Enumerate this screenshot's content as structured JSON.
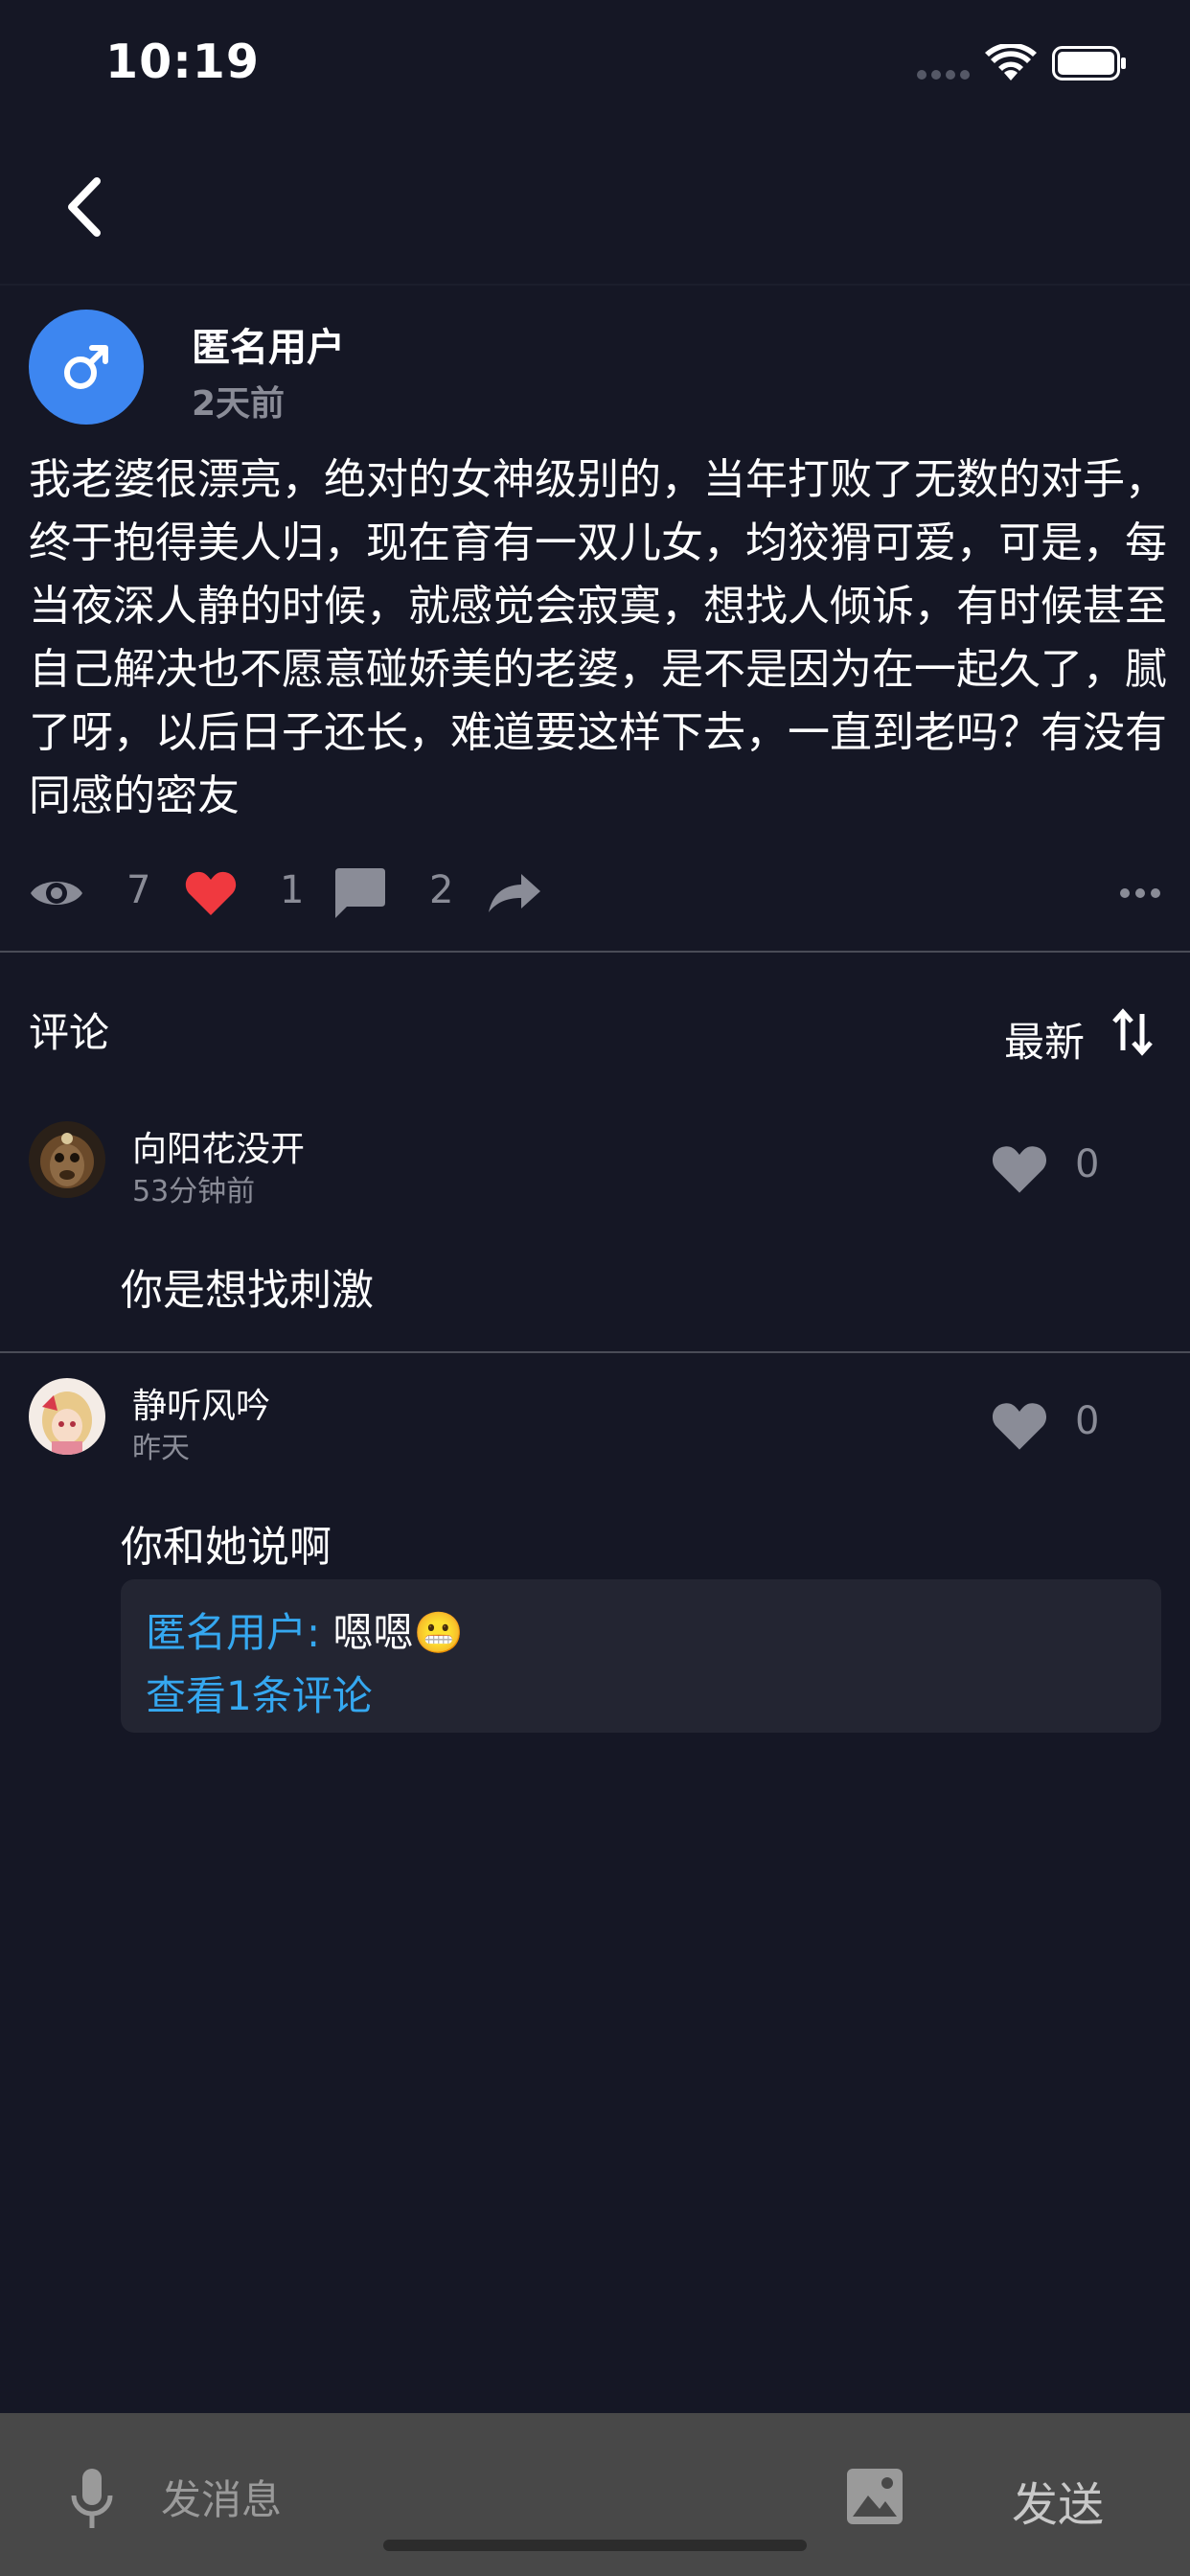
{
  "status_bar": {
    "time": "10:19"
  },
  "post": {
    "author": {
      "name": "匿名用户",
      "time": "2天前",
      "gender_symbol": "♂"
    },
    "body": "我老婆很漂亮，绝对的女神级别的，当年打败了无数的对手，终于抱得美人归，现在育有一双儿女，均狡猾可爱，可是，每当夜深人静的时候，就感觉会寂寞，想找人倾诉，有时候甚至自己解决也不愿意碰娇美的老婆，是不是因为在一起久了，腻了呀，以后日子还长，难道要这样下去，一直到老吗？有没有同感的密友",
    "stats": {
      "views": "7",
      "likes": "1",
      "comments": "2"
    }
  },
  "comments_section": {
    "title": "评论",
    "sort_label": "最新",
    "items": [
      {
        "username": "向阳花没开",
        "time": "53分钟前",
        "likes": "0",
        "text": "你是想找刺激"
      },
      {
        "username": "静听风吟",
        "time": "昨天",
        "likes": "0",
        "text": "你和她说啊",
        "reply": {
          "author": "匿名用户:",
          "text": " 嗯嗯😬",
          "view_more": "查看1条评论"
        }
      }
    ]
  },
  "bottom_bar": {
    "input_placeholder": "发消息",
    "send_label": "发送"
  },
  "colors": {
    "background": "#151725",
    "accent_blue": "#35a8f0",
    "avatar_blue": "#3d86f0",
    "like_red": "#f0393f",
    "muted_text": "#8a8c97"
  }
}
